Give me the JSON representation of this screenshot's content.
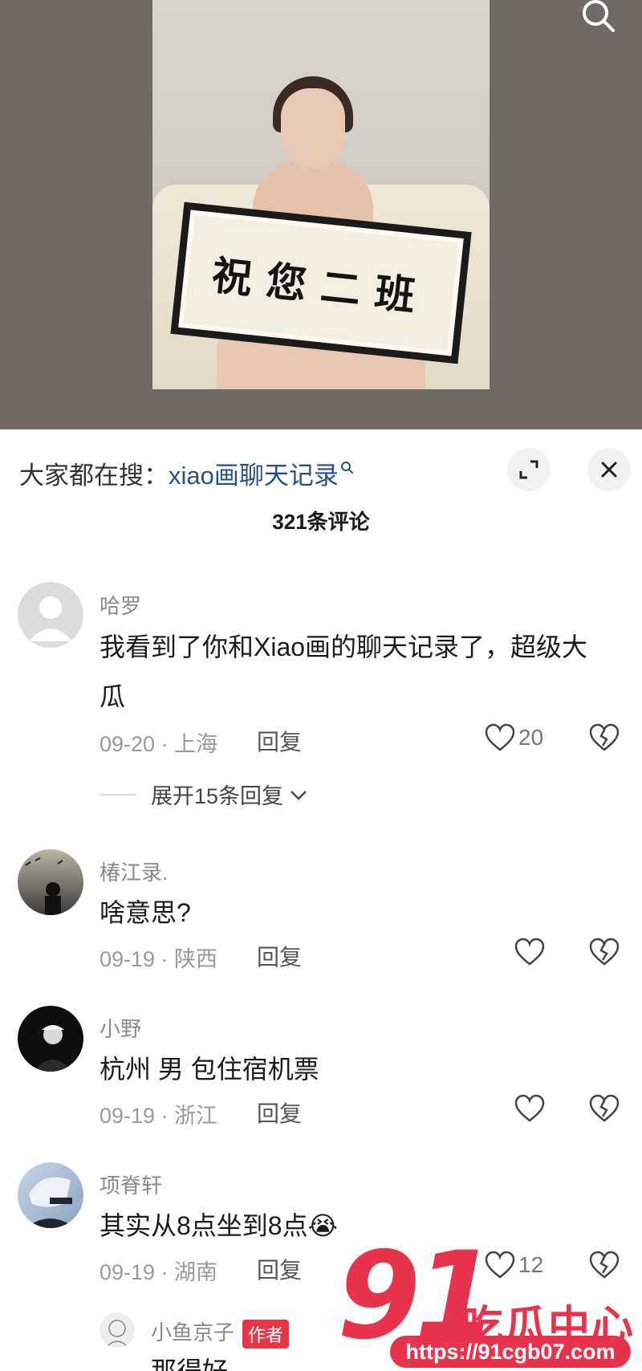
{
  "poster": {
    "sign_text": "祝您二班"
  },
  "search_bar": {
    "label": "大家都在搜：",
    "query": "xiao画聊天记录"
  },
  "comments_header": {
    "count_text": "321条评论"
  },
  "comments": [
    {
      "username": "哈罗",
      "text": "我看到了你和Xiao画的聊天记录了，超级大瓜",
      "meta": "09-20 · 上海",
      "reply": "回复",
      "likes": "20",
      "expand": "展开15条回复"
    },
    {
      "username": "椿江录.",
      "text": "啥意思?",
      "meta": "09-19 · 陕西",
      "reply": "回复"
    },
    {
      "username": "小野",
      "text": "杭州 男 包住宿机票",
      "meta": "09-19 · 浙江",
      "reply": "回复"
    },
    {
      "username": "项脊轩",
      "text": "其实从8点坐到8点😭",
      "meta": "09-19 · 湖南",
      "reply": "回复",
      "likes": "12"
    },
    {
      "username": "小鱼京子",
      "badge": "作者",
      "text": "那得好..."
    }
  ],
  "watermark": {
    "number": "91",
    "title": "吃瓜中心",
    "url": "https://91cgb07.com"
  }
}
